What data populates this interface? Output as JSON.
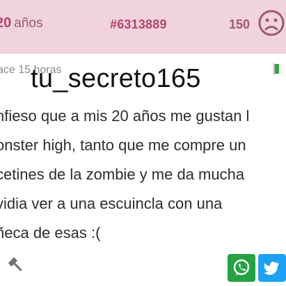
{
  "header": {
    "age_number": "20",
    "age_word": "años",
    "secret_id": "#6313889",
    "vote_count": "150",
    "reaction_icon": "sad-face-icon"
  },
  "meta": {
    "posted_time": "ace 15 horas",
    "flag_icon": "flag-icon"
  },
  "overlay": {
    "username": "tu_secreto165"
  },
  "post": {
    "lines": [
      "nfieso que a mis 20 años me gustan l",
      "onster high, tanto que me compre un",
      "cetines de la zombie y me da mucha",
      "vidia ver a una escuincla con una",
      "ñeca de esas :("
    ]
  },
  "footer": {
    "report_icon": "gavel-icon",
    "share_buttons": [
      "whatsapp-icon",
      "twitter-icon"
    ]
  },
  "colors": {
    "header_bg": "#f1d3dd",
    "accent": "#b0466b",
    "whatsapp": "#25a244",
    "twitter": "#1da1f2"
  }
}
